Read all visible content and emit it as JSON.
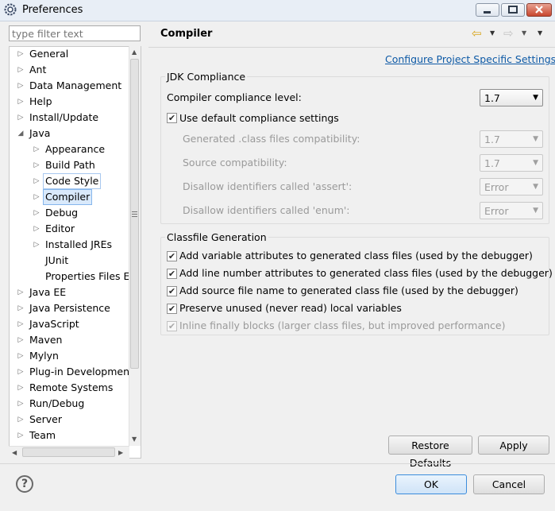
{
  "window": {
    "title": "Preferences"
  },
  "filter": {
    "placeholder": "type filter text"
  },
  "tree": {
    "items": [
      {
        "label": "General",
        "level": 0,
        "twisty": "collapsed"
      },
      {
        "label": "Ant",
        "level": 0,
        "twisty": "collapsed"
      },
      {
        "label": "Data Management",
        "level": 0,
        "twisty": "collapsed"
      },
      {
        "label": "Help",
        "level": 0,
        "twisty": "collapsed"
      },
      {
        "label": "Install/Update",
        "level": 0,
        "twisty": "collapsed"
      },
      {
        "label": "Java",
        "level": 0,
        "twisty": "expanded"
      },
      {
        "label": "Appearance",
        "level": 1,
        "twisty": "collapsed"
      },
      {
        "label": "Build Path",
        "level": 1,
        "twisty": "collapsed"
      },
      {
        "label": "Code Style",
        "level": 1,
        "twisty": "collapsed",
        "hover": true
      },
      {
        "label": "Compiler",
        "level": 1,
        "twisty": "collapsed",
        "selected": true
      },
      {
        "label": "Debug",
        "level": 1,
        "twisty": "collapsed"
      },
      {
        "label": "Editor",
        "level": 1,
        "twisty": "collapsed"
      },
      {
        "label": "Installed JREs",
        "level": 1,
        "twisty": "collapsed"
      },
      {
        "label": "JUnit",
        "level": 1,
        "twisty": "none"
      },
      {
        "label": "Properties Files Ed",
        "level": 1,
        "twisty": "none"
      },
      {
        "label": "Java EE",
        "level": 0,
        "twisty": "collapsed"
      },
      {
        "label": "Java Persistence",
        "level": 0,
        "twisty": "collapsed"
      },
      {
        "label": "JavaScript",
        "level": 0,
        "twisty": "collapsed"
      },
      {
        "label": "Maven",
        "level": 0,
        "twisty": "collapsed"
      },
      {
        "label": "Mylyn",
        "level": 0,
        "twisty": "collapsed"
      },
      {
        "label": "Plug-in Development",
        "level": 0,
        "twisty": "collapsed"
      },
      {
        "label": "Remote Systems",
        "level": 0,
        "twisty": "collapsed"
      },
      {
        "label": "Run/Debug",
        "level": 0,
        "twisty": "collapsed"
      },
      {
        "label": "Server",
        "level": 0,
        "twisty": "collapsed"
      },
      {
        "label": "Team",
        "level": 0,
        "twisty": "collapsed"
      }
    ]
  },
  "page": {
    "title": "Compiler",
    "configure_link": "Configure Project Specific Settings..."
  },
  "jdk": {
    "group_title": "JDK Compliance",
    "compliance_label": "Compiler compliance level:",
    "compliance_value": "1.7",
    "use_default_label": "Use default compliance settings",
    "use_default_checked": true,
    "generated_label": "Generated .class files compatibility:",
    "generated_value": "1.7",
    "source_label": "Source compatibility:",
    "source_value": "1.7",
    "assert_label": "Disallow identifiers called 'assert':",
    "assert_value": "Error",
    "enum_label": "Disallow identifiers called 'enum':",
    "enum_value": "Error"
  },
  "classfile": {
    "group_title": "Classfile Generation",
    "options": [
      {
        "label": "Add variable attributes to generated class files (used by the debugger)",
        "checked": true,
        "enabled": true
      },
      {
        "label": "Add line number attributes to generated class files (used by the debugger)",
        "checked": true,
        "enabled": true
      },
      {
        "label": "Add source file name to generated class file (used by the debugger)",
        "checked": true,
        "enabled": true
      },
      {
        "label": "Preserve unused (never read) local variables",
        "checked": true,
        "enabled": true
      },
      {
        "label": "Inline finally blocks (larger class files, but improved performance)",
        "checked": true,
        "enabled": false
      }
    ]
  },
  "buttons": {
    "restore_defaults": "Restore Defaults",
    "apply": "Apply",
    "ok": "OK",
    "cancel": "Cancel"
  }
}
